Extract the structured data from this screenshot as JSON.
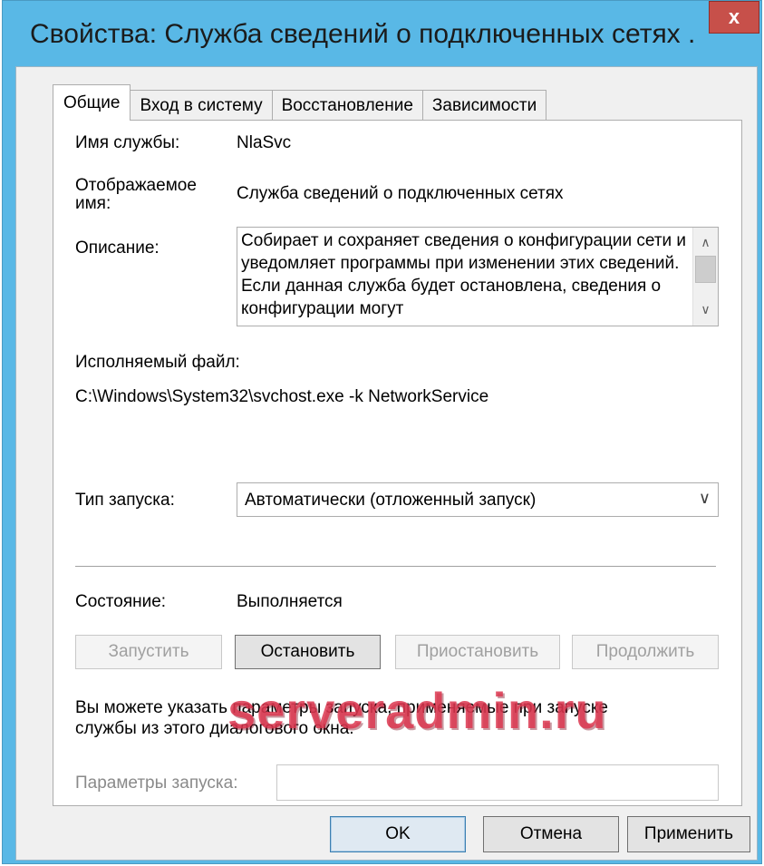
{
  "window": {
    "title": "Свойства: Служба сведений о подключенных сетях ...",
    "close_label": "x"
  },
  "tabs": [
    {
      "label": "Общие",
      "active": true
    },
    {
      "label": "Вход в систему",
      "active": false
    },
    {
      "label": "Восстановление",
      "active": false
    },
    {
      "label": "Зависимости",
      "active": false
    }
  ],
  "general": {
    "service_name_label": "Имя службы:",
    "service_name_value": "NlaSvc",
    "display_name_label_line1": "Отображаемое",
    "display_name_label_line2": "имя:",
    "display_name_value": "Служба сведений о подключенных сетях",
    "description_label": "Описание:",
    "description_value": "Собирает и сохраняет сведения о конфигурации сети и уведомляет программы при изменении этих сведений. Если данная служба будет остановлена, сведения о конфигурации могут",
    "executable_label": "Исполняемый файл:",
    "executable_value": "C:\\Windows\\System32\\svchost.exe -k NetworkService",
    "startup_type_label": "Тип запуска:",
    "startup_type_value": "Автоматически (отложенный запуск)",
    "status_label": "Состояние:",
    "status_value": "Выполняется",
    "buttons": {
      "start": "Запустить",
      "stop": "Остановить",
      "pause": "Приостановить",
      "resume": "Продолжить"
    },
    "hint_line1": "Вы можете указать параметры запуска, применяемые при запуске",
    "hint_line2": "службы из этого диалогового окна.",
    "start_params_label": "Параметры запуска:",
    "start_params_value": ""
  },
  "watermark": "serveradmin.ru",
  "footer": {
    "ok": "OK",
    "cancel": "Отмена",
    "apply": "Применить"
  },
  "icons": {
    "scroll_up": "chevron-up-icon",
    "scroll_down": "chevron-down-icon",
    "dropdown": "chevron-down-icon"
  }
}
